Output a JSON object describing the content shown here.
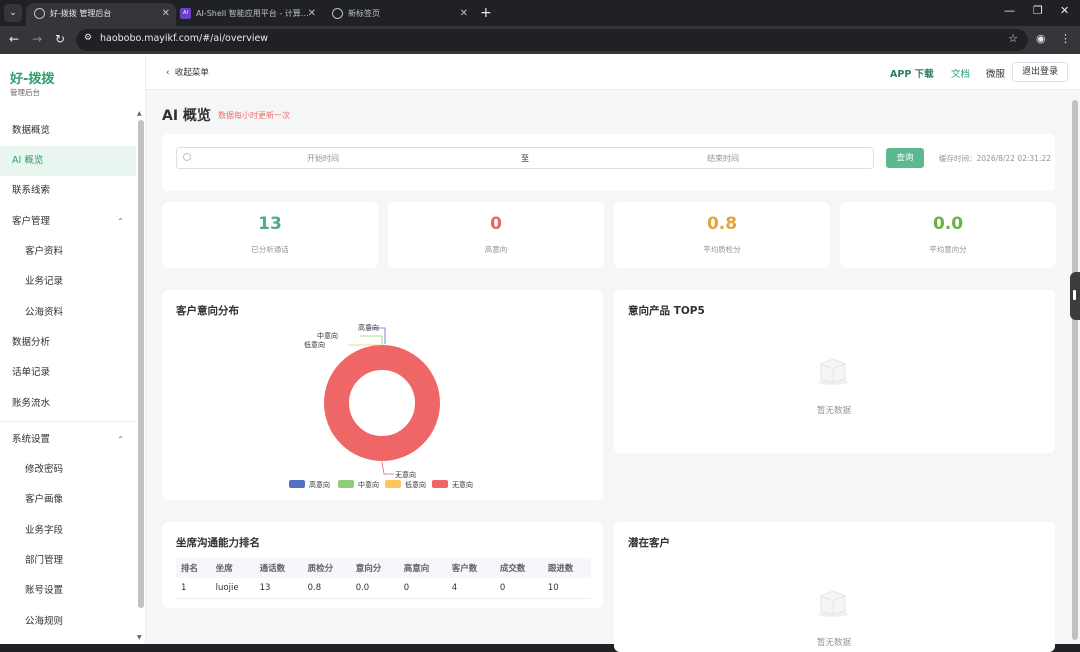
{
  "browser": {
    "tabs": [
      {
        "title": "好-拨拨 管理后台",
        "active": true
      },
      {
        "title": "AI-Shell 智能应用平台 - 计算…",
        "active": false
      },
      {
        "title": "新标签页",
        "active": false
      }
    ],
    "url": "haobobo.mayikf.com/#/ai/overview"
  },
  "sidebar": {
    "brand": "好-拨拨",
    "brand_sub": "管理后台",
    "items": [
      {
        "label": "数据概览"
      },
      {
        "label": "AI 概览"
      },
      {
        "label": "联系线索"
      },
      {
        "label": "客户管理"
      },
      {
        "label": "客户资料"
      },
      {
        "label": "业务记录"
      },
      {
        "label": "公海资料"
      },
      {
        "label": "数据分析"
      },
      {
        "label": "话单记录"
      },
      {
        "label": "账务流水"
      },
      {
        "label": "系统设置"
      },
      {
        "label": "修改密码"
      },
      {
        "label": "客户画像"
      },
      {
        "label": "业务字段"
      },
      {
        "label": "部门管理"
      },
      {
        "label": "账号设置"
      },
      {
        "label": "公海规则"
      }
    ]
  },
  "header": {
    "collapse": "收起菜单",
    "app_download": "APP 下载",
    "docs": "文档",
    "wechat": "微服",
    "logout": "退出登录"
  },
  "page": {
    "title": "AI 概览",
    "note": "数据每小时更新一次"
  },
  "filter": {
    "start_placeholder": "开始时间",
    "separator": "至",
    "end_placeholder": "结束时间",
    "query": "查询",
    "cache_time": "缓存时间：2026/8/22 02:31:22"
  },
  "stats": [
    {
      "value": "13",
      "label": "已分析通话",
      "color": "#4caf7d"
    },
    {
      "value": "0",
      "label": "高意向",
      "color": "#e8636a"
    },
    {
      "value": "0.8",
      "label": "平均质检分",
      "color": "#e6a23c"
    },
    {
      "value": "0.0",
      "label": "平均意向分",
      "color": "#67b248"
    }
  ],
  "intent_chart": {
    "title": "客户意向分布",
    "chart_data": {
      "type": "pie",
      "categories": [
        "高意向",
        "中意向",
        "低意向",
        "无意向"
      ],
      "values": [
        0,
        0,
        0,
        13
      ],
      "colors": [
        "#5470c6",
        "#91cc75",
        "#fac858",
        "#ee6666"
      ],
      "legend_position": "bottom"
    }
  },
  "top5": {
    "title": "意向产品 TOP5",
    "empty": "暂无数据"
  },
  "ranking": {
    "title": "坐席沟通能力排名",
    "columns": [
      "排名",
      "坐席",
      "通话数",
      "质检分",
      "意向分",
      "高意向",
      "客户数",
      "成交数",
      "跟进数"
    ],
    "rows": [
      [
        "1",
        "luojie",
        "13",
        "0.8",
        "0.0",
        "0",
        "4",
        "0",
        "10"
      ]
    ]
  },
  "potential": {
    "title": "潜在客户",
    "empty": "暂无数据"
  }
}
